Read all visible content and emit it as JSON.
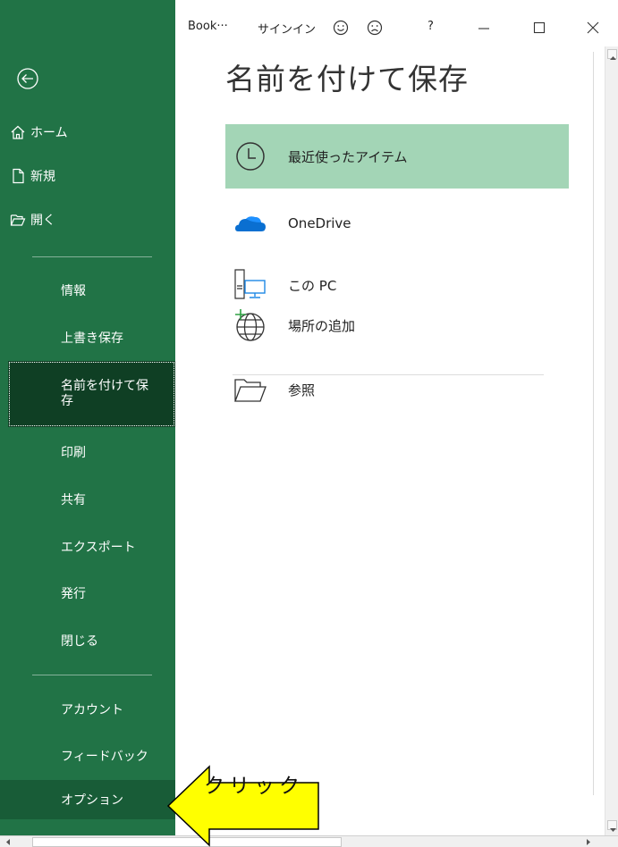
{
  "topbar": {
    "book": "Book···",
    "signin": "サインイン",
    "help": "?",
    "minimize_icon": "minimize-icon",
    "maximize_icon": "maximize-icon",
    "close_icon": "close-icon"
  },
  "sidebar": {
    "back_icon": "back-arrow-icon",
    "top_items": [
      {
        "label": "ホーム",
        "icon": "home-icon"
      },
      {
        "label": "新規",
        "icon": "new-document-icon"
      },
      {
        "label": "開く",
        "icon": "open-folder-icon"
      }
    ],
    "items": [
      {
        "label": "情報"
      },
      {
        "label": "上書き保存"
      },
      {
        "label": "名前を付けて保存",
        "selected": true
      },
      {
        "label": "印刷"
      },
      {
        "label": "共有"
      },
      {
        "label": "エクスポート"
      },
      {
        "label": "発行"
      },
      {
        "label": "閉じる"
      }
    ],
    "bottom_items": [
      {
        "label": "アカウント"
      },
      {
        "label": "フィードバック"
      },
      {
        "label": "オプション"
      }
    ],
    "selected_label_line1": "名前を付けて保",
    "selected_label_line2": "存"
  },
  "main": {
    "title": "名前を付けて保存",
    "locations": [
      {
        "label": "最近使ったアイテム",
        "icon": "clock-icon",
        "selected": true
      },
      {
        "label": "OneDrive",
        "icon": "cloud-icon"
      },
      {
        "label": "この PC",
        "icon": "computer-icon"
      },
      {
        "label": "場所の追加",
        "icon": "globe-add-icon"
      },
      {
        "label": "参照",
        "icon": "folder-icon"
      }
    ]
  },
  "annotation": {
    "text": "クリック",
    "arrow_color": "#ffff00",
    "arrow_border": "#000000"
  },
  "colors": {
    "sidebar": "#217346",
    "selected_nav": "#0f3f24",
    "selected_location": "#a3d5b6"
  }
}
